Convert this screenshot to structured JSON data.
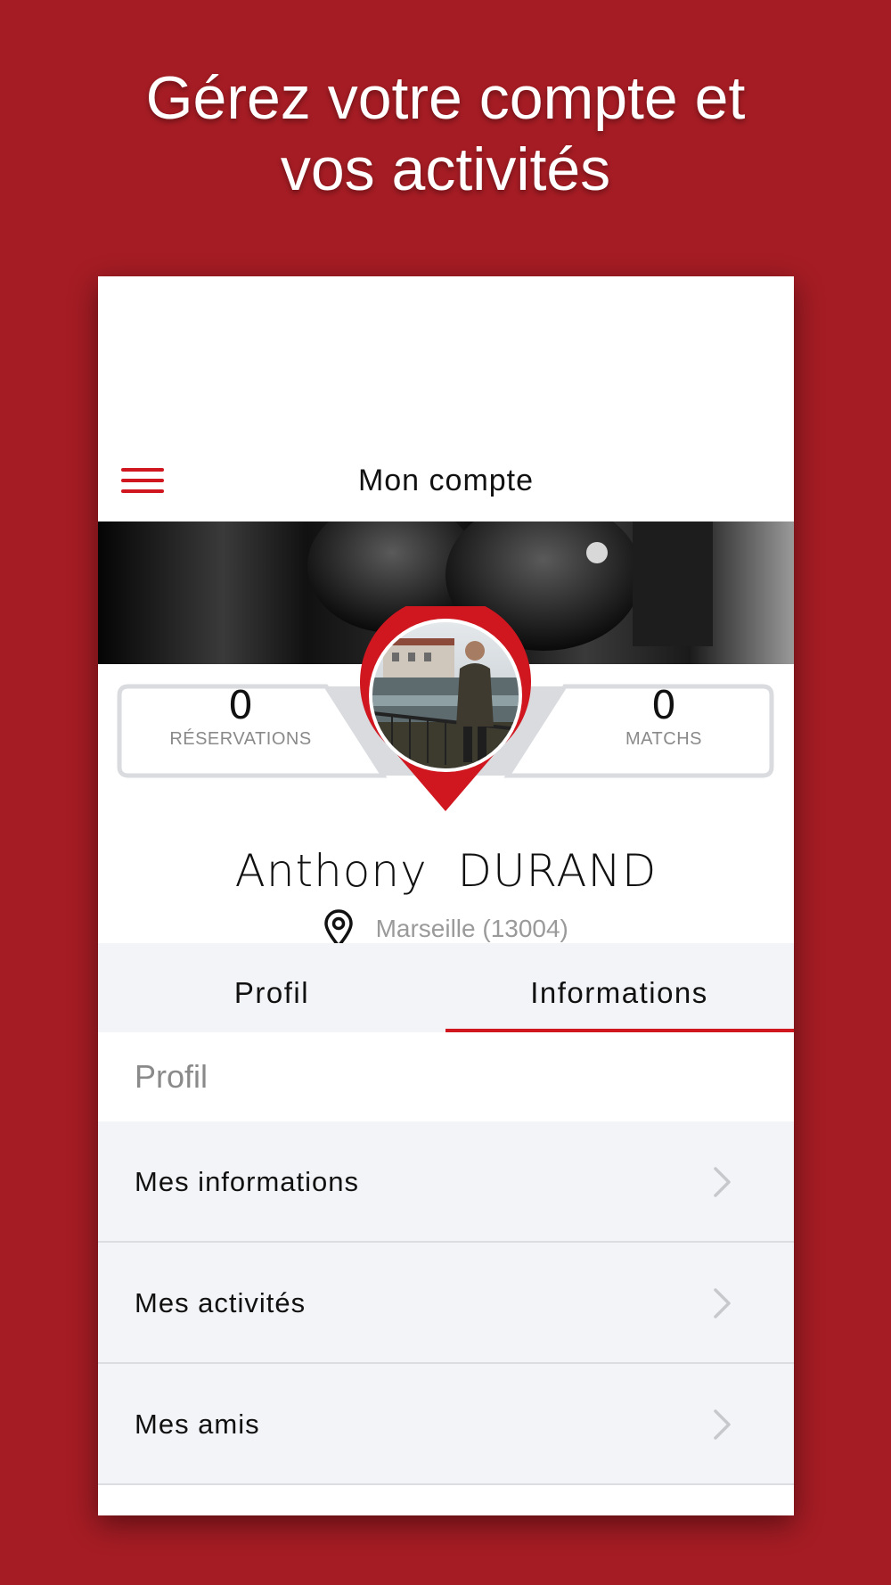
{
  "promo": {
    "line1": "Gérez votre compte et",
    "line2": "vos activités"
  },
  "header": {
    "title": "Mon compte",
    "menu_icon": "hamburger-menu-icon"
  },
  "stats": {
    "reservations": {
      "value": "0",
      "label": "RÉSERVATIONS"
    },
    "matchs": {
      "value": "0",
      "label": "MATCHS"
    }
  },
  "user": {
    "name": "Anthony  DURAND",
    "location": "Marseille (13004)"
  },
  "tabs": [
    {
      "label": "Profil",
      "active": false
    },
    {
      "label": "Informations",
      "active": true
    }
  ],
  "section": {
    "heading": "Profil"
  },
  "list": [
    {
      "label": "Mes informations"
    },
    {
      "label": "Mes activités"
    },
    {
      "label": "Mes amis"
    }
  ],
  "colors": {
    "background": "#A51C24",
    "accent": "#D0161F",
    "tab_bar": "#F3F4F7",
    "muted_text": "#8a8a8a"
  }
}
